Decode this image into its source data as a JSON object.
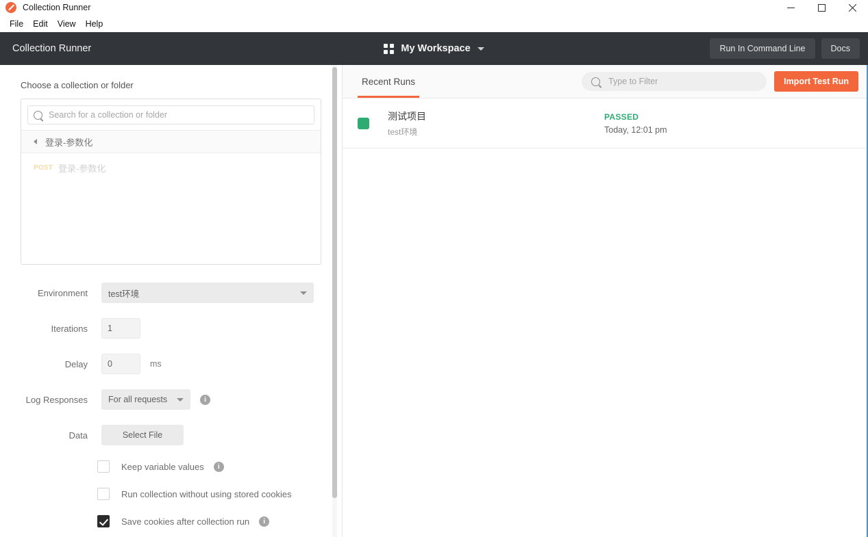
{
  "window": {
    "title": "Collection Runner",
    "logo_icon": "postman-logo-icon",
    "minimize_icon": "minimize-icon",
    "maximize_icon": "maximize-icon",
    "close_icon": "close-icon"
  },
  "menubar": {
    "items": [
      {
        "label": "File"
      },
      {
        "label": "Edit"
      },
      {
        "label": "View"
      },
      {
        "label": "Help"
      }
    ]
  },
  "header": {
    "app_title": "Collection Runner",
    "workspace_icon": "grid-icon",
    "workspace_name": "My Workspace",
    "workspace_caret_icon": "chevron-down-icon",
    "run_cli_label": "Run In Command Line",
    "docs_label": "Docs"
  },
  "left_panel": {
    "section_label": "Choose a collection or folder",
    "search": {
      "icon": "search-icon",
      "placeholder": "Search for a collection or folder",
      "value": ""
    },
    "breadcrumb": {
      "back_icon": "triangle-left-icon",
      "label": "登录-参数化"
    },
    "requests": [
      {
        "method": "POST",
        "name": "登录-参数化"
      }
    ],
    "environment": {
      "label": "Environment",
      "value": "test环境",
      "caret_icon": "chevron-down-icon"
    },
    "iterations": {
      "label": "Iterations",
      "value": "1"
    },
    "delay": {
      "label": "Delay",
      "value": "0",
      "unit": "ms"
    },
    "log_responses": {
      "label": "Log Responses",
      "value": "For all requests",
      "caret_icon": "chevron-down-icon",
      "info_icon": "info-icon"
    },
    "data": {
      "label": "Data",
      "button_label": "Select File"
    },
    "checkboxes": [
      {
        "label": "Keep variable values",
        "checked": false,
        "info_icon": "info-icon",
        "has_info": true
      },
      {
        "label": "Run collection without using stored cookies",
        "checked": false,
        "has_info": false
      },
      {
        "label": "Save cookies after collection run",
        "checked": true,
        "info_icon": "info-icon",
        "has_info": true
      }
    ]
  },
  "right_panel": {
    "tabs": [
      {
        "label": "Recent Runs",
        "active": true
      }
    ],
    "filter": {
      "icon": "search-icon",
      "placeholder": "Type to Filter",
      "value": ""
    },
    "import_label": "Import Test Run",
    "runs": [
      {
        "status_icon": "status-square-icon",
        "name": "测试项目",
        "environment": "test环境",
        "verdict": "PASSED",
        "time": "Today, 12:01 pm"
      }
    ]
  },
  "colors": {
    "accent": "#f2673c",
    "header_bg": "#32353a",
    "passed": "#2eab72"
  }
}
